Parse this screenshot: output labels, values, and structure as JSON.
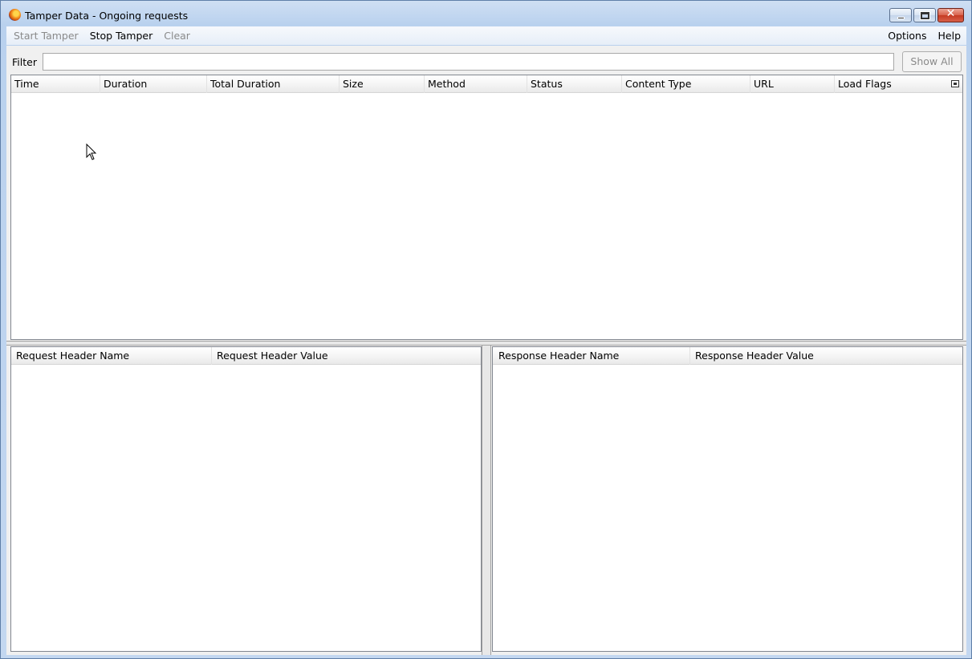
{
  "window": {
    "title": "Tamper Data - Ongoing requests",
    "close_glyph": "✕"
  },
  "menubar": {
    "start_tamper": "Start Tamper",
    "stop_tamper": "Stop Tamper",
    "clear": "Clear",
    "options": "Options",
    "help": "Help"
  },
  "filter": {
    "label": "Filter",
    "value": "",
    "show_all": "Show All"
  },
  "requests_table": {
    "columns": [
      "Time",
      "Duration",
      "Total Duration",
      "Size",
      "Method",
      "Status",
      "Content Type",
      "URL",
      "Load Flags"
    ],
    "rows": []
  },
  "request_headers_table": {
    "columns": [
      "Request Header Name",
      "Request Header Value"
    ],
    "rows": []
  },
  "response_headers_table": {
    "columns": [
      "Response Header Name",
      "Response Header Value"
    ],
    "rows": []
  },
  "icons": {
    "app": "firefox-icon",
    "minimize": "minimize-icon",
    "maximize": "maximize-icon",
    "close": "close-icon",
    "column_picker": "column-picker-icon",
    "cursor": "mouse-cursor-icon"
  },
  "colors": {
    "title_gradient_top": "#cfdff3",
    "close_button": "#c53a22",
    "disabled_text": "#8a8a8a"
  }
}
